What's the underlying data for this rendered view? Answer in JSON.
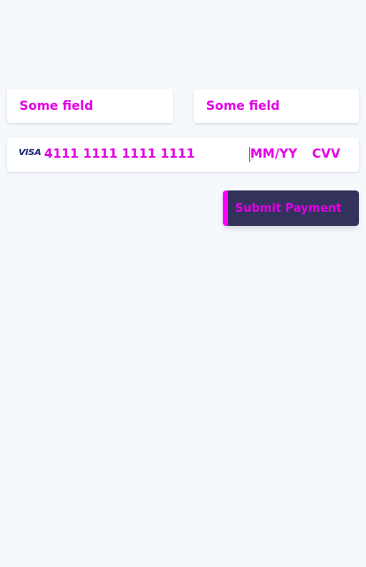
{
  "form": {
    "field_1": {
      "placeholder": "Some field",
      "value": ""
    },
    "field_2": {
      "placeholder": "Some field",
      "value": ""
    },
    "card": {
      "brand_icon": "visa-icon",
      "brand_text": "VISA",
      "number_value": "4111 1111 1111 1111",
      "expiry_placeholder": "MM/YY",
      "cvc_placeholder": "CVV"
    },
    "submit_label": "Submit Payment"
  },
  "colors": {
    "background": "#f6f9fc",
    "field_background": "#ffffff",
    "text": "#e400e4",
    "button_background": "#32325d",
    "brand": "#1a1f71"
  }
}
